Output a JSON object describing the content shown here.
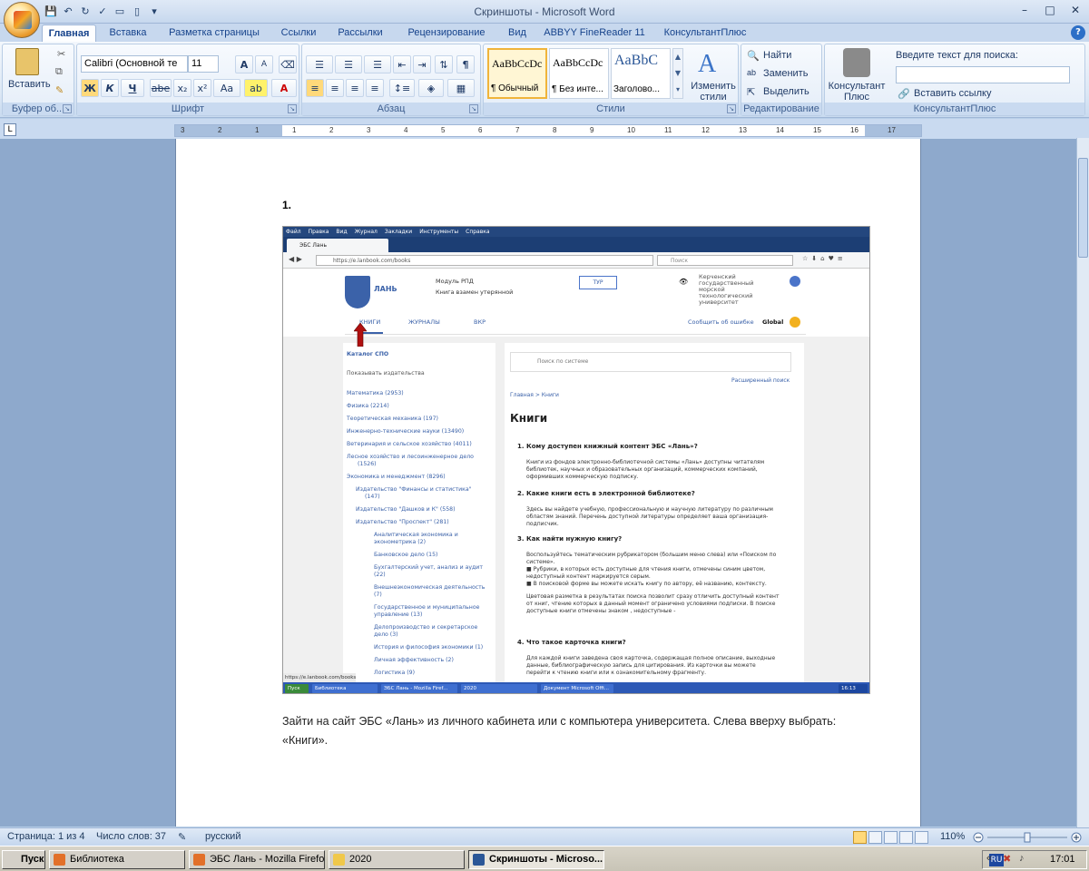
{
  "window": {
    "title": "Скриншоты - Microsoft Word",
    "minimize": "–",
    "maximize": "□",
    "close": "✕"
  },
  "ribbon_tabs": [
    "Главная",
    "Вставка",
    "Разметка страницы",
    "Ссылки",
    "Рассылки",
    "Рецензирование",
    "Вид",
    "ABBYY FineReader 11",
    "КонсультантПлюс"
  ],
  "ribbon": {
    "clipboard": {
      "paste_label": "Вставить",
      "group_label": "Буфер об..."
    },
    "font": {
      "font_name": "Calibri (Основной те",
      "font_size": "11",
      "group_label": "Шрифт",
      "bold": "Ж",
      "italic": "К",
      "underline": "Ч",
      "strike": "abe",
      "sub": "x₂",
      "sup": "x²",
      "case": "Aa"
    },
    "paragraph": {
      "group_label": "Абзац"
    },
    "styles": {
      "group_label": "Стили",
      "items": [
        {
          "preview": "AaBbCcDc",
          "name": "¶ Обычный"
        },
        {
          "preview": "AaBbCcDc",
          "name": "¶ Без инте..."
        },
        {
          "preview": "AaBbC",
          "name": "Заголово..."
        }
      ],
      "change_styles": "Изменить стили"
    },
    "editing": {
      "group_label": "Редактирование",
      "find": "Найти",
      "replace": "Заменить",
      "select": "Выделить"
    },
    "consultant": {
      "group_label": "КонсультантПлюс",
      "button": "Консультант Плюс",
      "search_label": "Введите текст для поиска:",
      "search_value": "",
      "insert_link": "Вставить ссылку"
    }
  },
  "ruler": {
    "marks": [
      "3",
      "2",
      "1",
      "1",
      "2",
      "3",
      "4",
      "5",
      "6",
      "7",
      "8",
      "9",
      "10",
      "11",
      "12",
      "13",
      "14",
      "15",
      "16",
      "17"
    ]
  },
  "document": {
    "heading_number": "1.",
    "paragraph": "Зайти на сайт ЭБС «Лань» из личного кабинета или с компьютера  университета. Слева вверху выбрать: «Книги»."
  },
  "screenshot": {
    "firefox_menu": [
      "Файл",
      "Правка",
      "Вид",
      "Журнал",
      "Закладки",
      "Инструменты",
      "Справка"
    ],
    "tab_title": "ЭБС Лань",
    "url": "https://e.lanbook.com/books",
    "search_placeholder": "Поиск",
    "brand": "ЛАНЬ",
    "module": "Модуль РПД",
    "book_swap": "Книга взамен утерянной",
    "tour": "ТУР",
    "university": "Керченский государственный морской технологический университет",
    "nav": [
      "КНИГИ",
      "ЖУРНАЛЫ",
      "ВКР"
    ],
    "report_error": "Сообщить об ошибке",
    "global": "Global",
    "sidebar": {
      "catalog": "Каталог СПО",
      "show_publishers": "Показывать издательства",
      "items": [
        "Математика (2953)",
        "Физика (2214)",
        "Теоретическая механика (197)",
        "Инженерно-технические науки (13490)",
        "Ветеринария и сельское хозяйство (4011)",
        "Лесное хозяйство и лесоинженерное дело",
        "(1526)",
        "Экономика и менеджмент (8296)",
        "Издательство \"Финансы и статистика\"",
        "(147)",
        "Издательство \"Дашков и К\" (558)",
        "Издательство \"Проспект\" (281)",
        "Аналитическая экономика и",
        "эконометрика (2)",
        "Банковское дело (15)",
        "Бухгалтерский учет, анализ и аудит",
        "(22)",
        "Внешнеэкономическая деятельность",
        "(7)",
        "Государственное и муниципальное",
        "управление (13)",
        "Делопроизводство и секретарское",
        "дело (3)",
        "История и философия экономики (1)",
        "Личная эффективность (2)",
        "Логистика (9)"
      ]
    },
    "main": {
      "search_placeholder": "Поиск по системе",
      "advanced": "Расширенный поиск",
      "breadcrumb": "Главная  >  Книги",
      "title": "Книги",
      "q1": "1. Кому доступен книжный контент ЭБС «Лань»?",
      "a1": [
        "Книги из фондов электронно-библиотечной системы «Лань» доступны читателям",
        "библиотек, научных и образовательных организаций, коммерческих компаний,",
        "оформивших коммерческую подписку."
      ],
      "q2": "2. Какие книги есть в электронной библиотеке?",
      "a2": [
        "Здесь вы найдете учебную, профессиональную и научную литературу по различным",
        "областям знаний. Перечень доступной литературы определяет ваша организация-",
        "подписчик."
      ],
      "q3": "3. Как найти нужную книгу?",
      "a3": [
        "Воспользуйтесь тематическим рубрикатором (большим меню слева) или «Поиском по",
        "системе».",
        "■  Рубрики, в которых есть доступные для чтения книги, отмечены синим цветом,",
        "    недоступный контент маркируется серым.",
        "■  В поисковой форме вы можете искать книгу по автору, её названию, контексту.",
        "Цветовая разметка в результатах поиска позволит сразу отличить доступный контент",
        "от книг, чтение которых в данный момент ограничено условиями подписки. В поиске",
        "доступные книги отмечены знаком  , недоступные -"
      ],
      "q4": "4. Что такое карточка книги?",
      "a4": [
        "Для каждой книги заведена своя карточка, содержащая полное описание, выходные",
        "данные, библиографическую запись для цитирования. Из карточки вы можете",
        "перейти к чтению книги или к ознакомительному фрагменту."
      ]
    },
    "status_url": "https://e.lanbook.com/books",
    "taskbar": [
      "Пуск",
      "Библиотека",
      "ЭБС Лань - Mozilla Firef...",
      "2020",
      "Документ Microsoft Offi..."
    ],
    "clock": "16:13"
  },
  "statusbar": {
    "page": "Страница: 1 из 4",
    "words": "Число слов: 37",
    "lang": "русский",
    "zoom": "110%"
  },
  "taskbar": {
    "start": "Пуск",
    "items": [
      "Библиотека",
      "ЭБС Лань - Mozilla Firefox",
      "2020",
      "Скриншоты - Microso..."
    ],
    "lang": "RU",
    "time": "17:01"
  },
  "colors": {
    "accent": "#15428b",
    "lan_blue": "#3b62a9",
    "arrow_red": "#b01010"
  }
}
